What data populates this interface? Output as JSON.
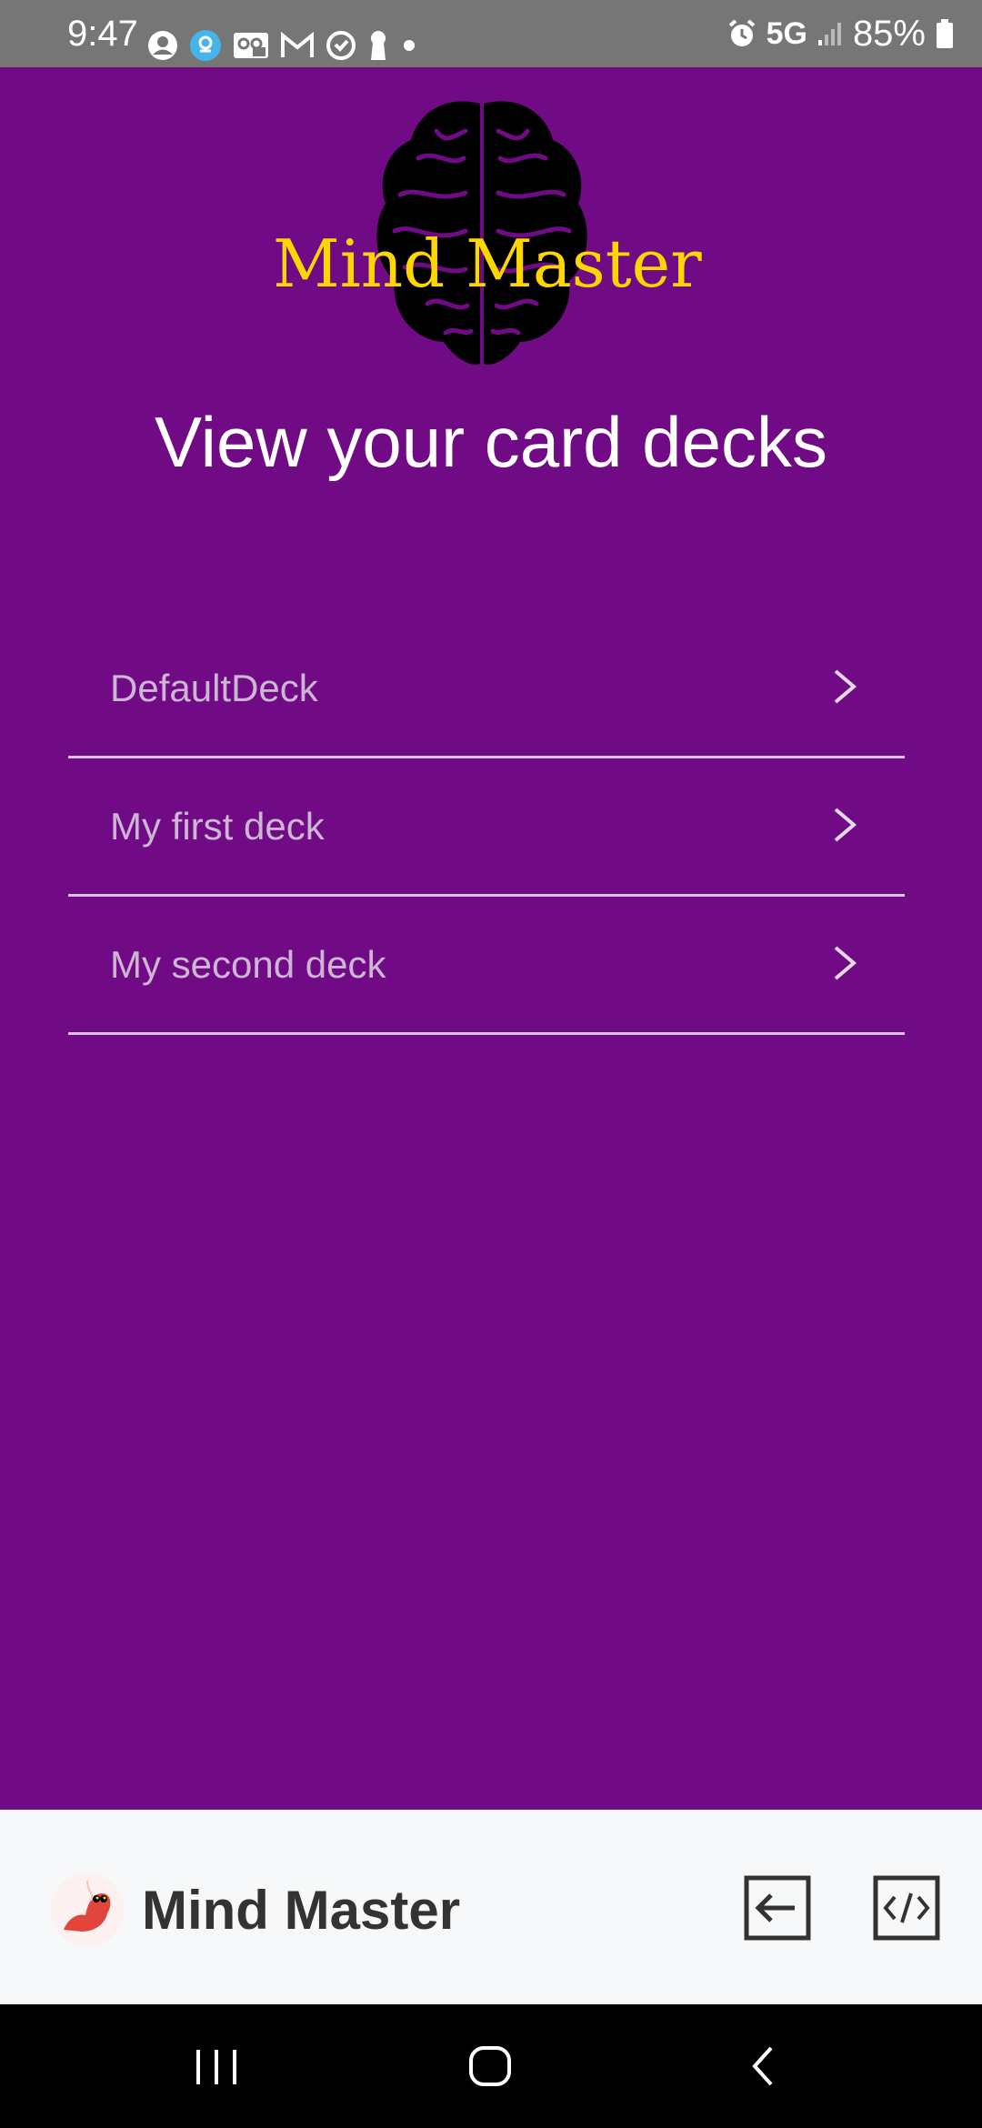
{
  "status_bar": {
    "time": "9:47",
    "network": "5G",
    "battery": "85%",
    "left_icons": [
      "account-icon",
      "location-pin-icon",
      "voicemail-icon",
      "gmail-icon",
      "heart-check-icon",
      "keyhole-icon",
      "dot-icon"
    ],
    "right_icons": [
      "alarm-icon",
      "signal-icon",
      "battery-icon"
    ]
  },
  "header": {
    "logo_text": "Mind Master",
    "logo_icon": "brain-icon",
    "title": "View your card decks"
  },
  "decks": [
    {
      "label": "DefaultDeck"
    },
    {
      "label": "My first deck"
    },
    {
      "label": "My second deck"
    }
  ],
  "app_bar": {
    "name": "Mind Master",
    "buttons": [
      "exit-icon",
      "code-icon"
    ]
  },
  "nav_bar": {
    "buttons": [
      "recent-apps-icon",
      "home-icon",
      "back-icon"
    ]
  },
  "colors": {
    "background": "#710b85",
    "logo_text": "#ffd700",
    "title": "#ffffff",
    "deck_text": "#cdb5d4",
    "divider": "#d9c4df",
    "app_bar": "#f7f8fa",
    "status_bar": "#767676"
  }
}
